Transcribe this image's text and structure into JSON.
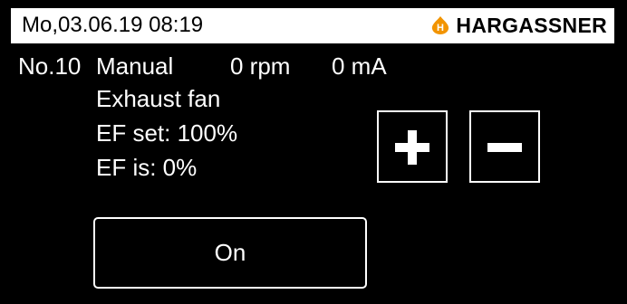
{
  "header": {
    "datetime": "Mo,03.06.19 08:19",
    "brand": "HARGASSNER",
    "logo_icon": "hargassner-flame-logo-icon",
    "logo_letter": "H",
    "logo_color": "#f29400"
  },
  "device": {
    "number": "No.10",
    "mode": "Manual",
    "rpm": "0 rpm",
    "current": "0 mA",
    "name": "Exhaust fan",
    "ef_set": "EF set: 100%",
    "ef_is": "EF is: 0%"
  },
  "controls": {
    "increase_icon": "plus-icon",
    "decrease_icon": "minus-icon",
    "toggle_label": "On"
  }
}
